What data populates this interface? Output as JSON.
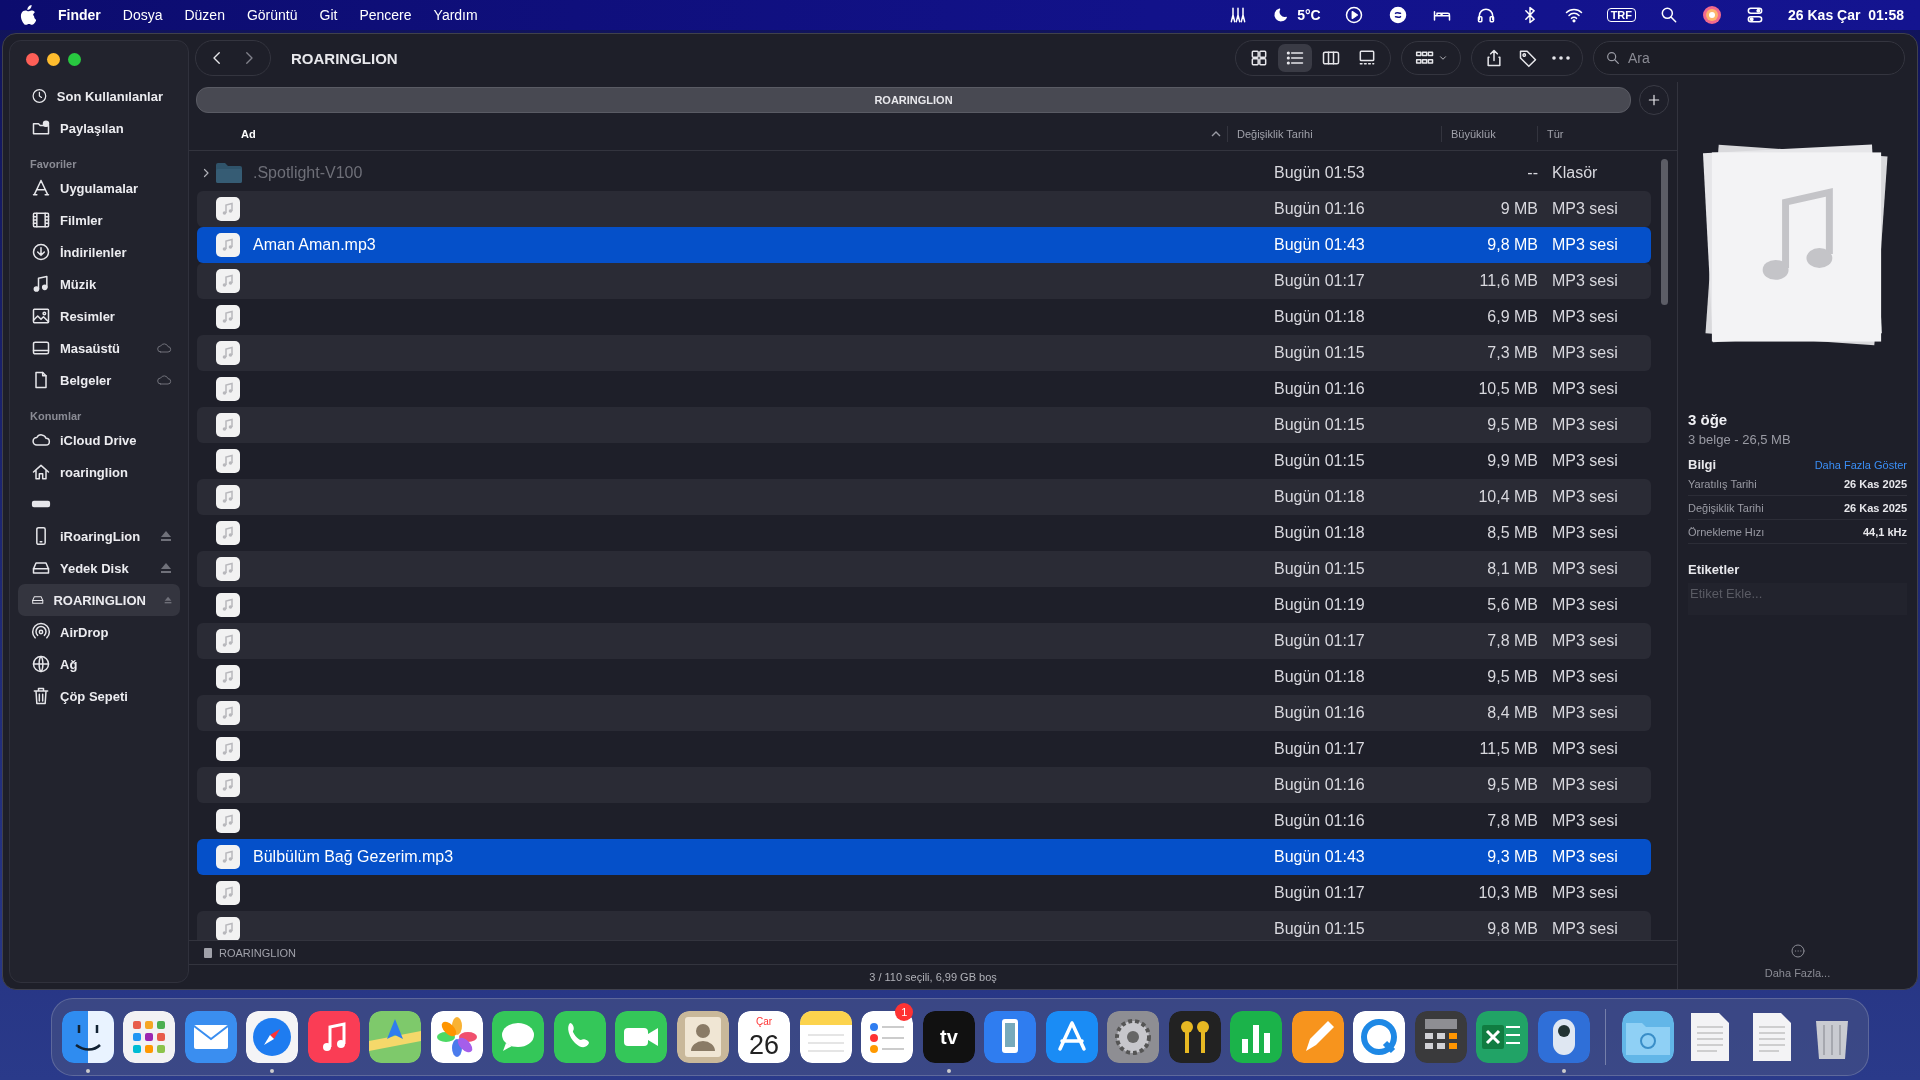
{
  "menu_bar": {
    "app_menu": "Finder",
    "menus": [
      "Dosya",
      "Düzen",
      "Görüntü",
      "Git",
      "Pencere",
      "Yardım"
    ],
    "weather": "5°C",
    "input_source": "TRF",
    "clock": "26 Kas Çar  01:58"
  },
  "window": {
    "title": "ROARINGLION",
    "sidebar": {
      "sections": [
        {
          "items": [
            {
              "label": "Son Kullanılanlar",
              "selected": false
            },
            {
              "label": "Paylaşılan",
              "selected": false
            }
          ]
        },
        {
          "header": "Favoriler",
          "items": [
            {
              "label": "Uygulamalar",
              "selected": false
            },
            {
              "label": "Filmler",
              "selected": false
            },
            {
              "label": "İndirilenler",
              "selected": false
            },
            {
              "label": "Müzik",
              "selected": false
            },
            {
              "label": "Resimler",
              "selected": false
            },
            {
              "label": "Masaüstü",
              "selected": false
            },
            {
              "label": "Belgeler",
              "selected": false
            }
          ]
        },
        {
          "header": "Konumlar",
          "items": [
            {
              "label": "iCloud Drive",
              "selected": false
            },
            {
              "label": "roaringlion",
              "selected": false
            },
            {
              "selected": false
            },
            {
              "label": "iRoaringLion",
              "selected": false
            },
            {
              "label": "Yedek Disk",
              "selected": false
            },
            {
              "label": "ROARINGLION",
              "selected": true
            },
            {
              "label": "AirDrop",
              "selected": false
            },
            {
              "label": "Ağ",
              "selected": false
            },
            {
              "label": "Çöp Sepeti",
              "selected": false
            }
          ]
        }
      ]
    },
    "toolbar": {
      "views": [
        {
          "kind": "icons",
          "selected": false
        },
        {
          "kind": "list",
          "selected": true
        },
        {
          "kind": "columns",
          "selected": false
        },
        {
          "kind": "gallery",
          "selected": false
        }
      ],
      "search": {
        "placeholder": "Ara"
      }
    },
    "path_tab": "ROARINGLION",
    "table": {
      "columns": [
        {
          "label": "Ad",
          "sorted": true
        },
        {
          "label": "Değişiklik Tarihi",
          "sorted": false
        },
        {
          "label": "Büyüklük",
          "sorted": false
        },
        {
          "label": "Tür",
          "sorted": false
        }
      ],
      "rows": [
        {
          "kind": "folder",
          "name": ".Spotlight-V100",
          "date": "Bugün 01:53",
          "size": "--",
          "type": "Klasör",
          "hidden": true,
          "selected": false
        },
        {
          "kind": "audio",
          "date": "Bugün 01:16",
          "size": "9 MB",
          "type": "MP3 sesi",
          "selected": false
        },
        {
          "kind": "audio",
          "name": "Aman Aman.mp3",
          "date": "Bugün 01:43",
          "size": "9,8 MB",
          "type": "MP3 sesi",
          "hidden": false,
          "selected": true
        },
        {
          "kind": "audio",
          "date": "Bugün 01:17",
          "size": "11,6 MB",
          "type": "MP3 sesi",
          "hidden": false,
          "selected": false
        },
        {
          "kind": "audio",
          "date": "Bugün 01:18",
          "size": "6,9 MB",
          "type": "MP3 sesi",
          "hidden": false,
          "selected": false
        },
        {
          "kind": "audio",
          "date": "Bugün 01:15",
          "size": "7,3 MB",
          "type": "MP3 sesi",
          "hidden": false,
          "selected": false
        },
        {
          "kind": "audio",
          "date": "Bugün 01:16",
          "size": "10,5 MB",
          "type": "MP3 sesi",
          "hidden": false,
          "selected": false
        },
        {
          "kind": "audio",
          "date": "Bugün 01:15",
          "size": "9,5 MB",
          "type": "MP3 sesi",
          "hidden": false,
          "selected": false
        },
        {
          "kind": "audio",
          "date": "Bugün 01:15",
          "size": "9,9 MB",
          "type": "MP3 sesi",
          "hidden": false,
          "selected": false
        },
        {
          "kind": "audio",
          "date": "Bugün 01:18",
          "size": "10,4 MB",
          "type": "MP3 sesi",
          "hidden": false,
          "selected": false
        },
        {
          "kind": "audio",
          "date": "Bugün 01:18",
          "size": "8,5 MB",
          "type": "MP3 sesi",
          "hidden": false,
          "selected": false
        },
        {
          "kind": "audio",
          "date": "Bugün 01:15",
          "size": "8,1 MB",
          "type": "MP3 sesi",
          "hidden": false,
          "selected": false
        },
        {
          "kind": "audio",
          "date": "Bugün 01:19",
          "size": "5,6 MB",
          "type": "MP3 sesi",
          "hidden": false,
          "selected": false
        },
        {
          "kind": "audio",
          "date": "Bugün 01:17",
          "size": "7,8 MB",
          "type": "MP3 sesi",
          "hidden": false,
          "selected": false
        },
        {
          "kind": "audio",
          "date": "Bugün 01:18",
          "size": "9,5 MB",
          "type": "MP3 sesi",
          "hidden": false,
          "selected": false
        },
        {
          "kind": "audio",
          "date": "Bugün 01:16",
          "size": "8,4 MB",
          "type": "MP3 sesi",
          "hidden": false,
          "selected": false
        },
        {
          "kind": "audio",
          "date": "Bugün 01:17",
          "size": "11,5 MB",
          "type": "MP3 sesi",
          "hidden": false,
          "selected": false
        },
        {
          "kind": "audio",
          "date": "Bugün 01:16",
          "size": "9,5 MB",
          "type": "MP3 sesi",
          "hidden": false,
          "selected": false
        },
        {
          "kind": "audio",
          "date": "Bugün 01:16",
          "size": "7,8 MB",
          "type": "MP3 sesi",
          "hidden": false,
          "selected": false
        },
        {
          "kind": "audio",
          "name": "Bülbülüm Bağ Gezerim.mp3",
          "date": "Bugün 01:43",
          "size": "9,3 MB",
          "type": "MP3 sesi",
          "hidden": false,
          "selected": true
        },
        {
          "kind": "audio",
          "date": "Bugün 01:17",
          "size": "10,3 MB",
          "type": "MP3 sesi",
          "hidden": false,
          "selected": false
        },
        {
          "kind": "audio",
          "date": "Bugün 01:15",
          "size": "9,8 MB",
          "type": "MP3 sesi",
          "hidden": false,
          "selected": false
        }
      ]
    },
    "path_bar": "ROARINGLION",
    "status": "3 / 110 seçili, 6,99 GB boş",
    "preview": {
      "title": "3 öğe",
      "subtitle": "3 belge - 26,5 MB",
      "info_heading": "Bilgi",
      "more_link": "Daha Fazla Göster",
      "info": [
        {
          "label": "Yaratılış Tarihi",
          "value": "26 Kas 2025"
        },
        {
          "label": "Değişiklik Tarihi",
          "value": "26 Kas 2025"
        },
        {
          "label": "Örnekleme Hızı",
          "value": "44,1 kHz"
        }
      ],
      "tags_heading": "Etiketler",
      "tags_field": {
        "placeholder": "Etiket Ekle..."
      },
      "more_button": "Daha Fazla..."
    }
  },
  "dock": {
    "items": [
      {
        "kind": "finder",
        "running": true
      },
      {
        "kind": "launchpad",
        "running": false
      },
      {
        "kind": "mail",
        "running": false
      },
      {
        "kind": "safari",
        "running": true
      },
      {
        "kind": "music",
        "running": false
      },
      {
        "kind": "maps",
        "running": false
      },
      {
        "kind": "photos",
        "running": false
      },
      {
        "kind": "messages",
        "running": false
      },
      {
        "kind": "phone",
        "running": false
      },
      {
        "kind": "facetime",
        "running": false
      },
      {
        "kind": "contacts",
        "running": false
      },
      {
        "kind": "calendar",
        "weekday": "Çar",
        "day": "26",
        "running": false
      },
      {
        "kind": "notes",
        "running": false
      },
      {
        "kind": "reminders",
        "badge": "1",
        "running": false
      },
      {
        "kind": "tv",
        "label": "tv",
        "running": true
      },
      {
        "kind": "device",
        "running": false
      },
      {
        "kind": "appstore",
        "running": false
      },
      {
        "kind": "settings",
        "running": false
      },
      {
        "kind": "keys",
        "running": false
      },
      {
        "kind": "numbers",
        "running": false
      },
      {
        "kind": "pages",
        "running": false
      },
      {
        "kind": "qapp",
        "running": false
      },
      {
        "kind": "calculator",
        "running": false
      },
      {
        "kind": "excel",
        "running": false
      },
      {
        "kind": "capsule",
        "running": true
      },
      {
        "kind": "separator"
      },
      {
        "kind": "folder",
        "running": false
      },
      {
        "kind": "doc",
        "running": false
      },
      {
        "kind": "doc",
        "running": false
      },
      {
        "kind": "trash",
        "running": false
      }
    ]
  }
}
